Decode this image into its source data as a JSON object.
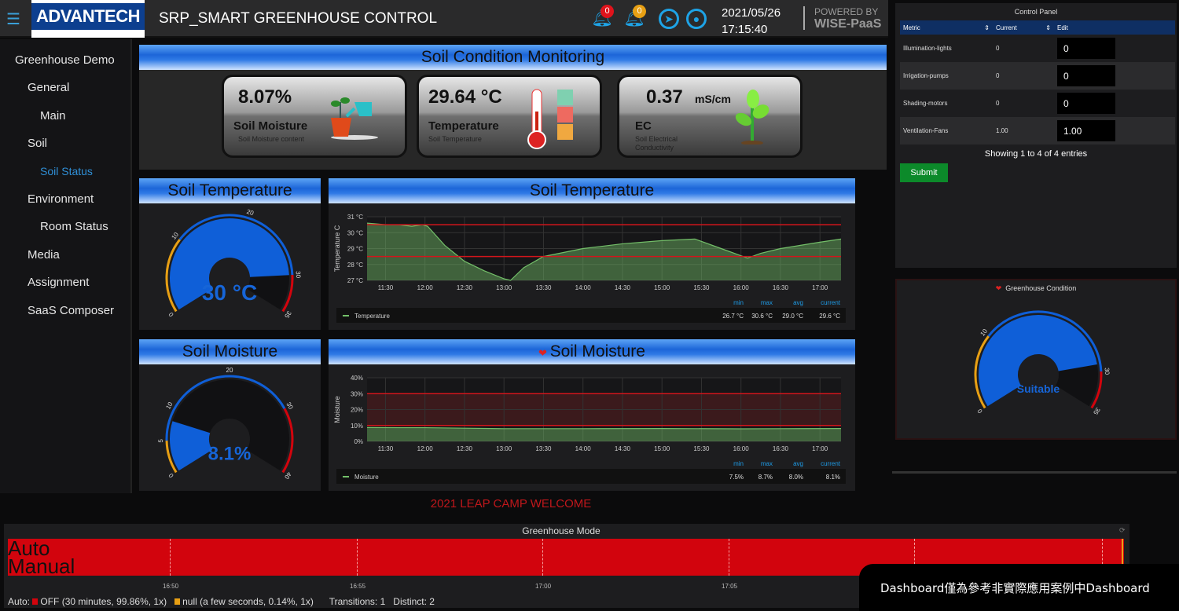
{
  "header": {
    "menu_icon": "hamburger-icon",
    "logo": "ADVANTECH",
    "title": "SRP_SMART GREENHOUSE CONTROL",
    "alerts": [
      {
        "icon": "bell-icon",
        "count": "0",
        "color": "#e0131b"
      },
      {
        "icon": "bell-icon",
        "count": "0",
        "color": "#e8a014"
      }
    ],
    "date": "2021/05/26",
    "time": "17:15:40",
    "powered_by": "POWERED BY",
    "platform": "WISE-PaaS"
  },
  "sidebar": {
    "items": [
      {
        "label": "Greenhouse Demo",
        "level": 0
      },
      {
        "label": "General",
        "level": 1
      },
      {
        "label": "Main",
        "level": 2
      },
      {
        "label": "Soil",
        "level": 1
      },
      {
        "label": "Soil Status",
        "level": 2,
        "active": true
      },
      {
        "label": "Environment",
        "level": 1
      },
      {
        "label": "Room Status",
        "level": 2
      },
      {
        "label": "Media",
        "level": 1
      },
      {
        "label": "Assignment",
        "level": 1
      },
      {
        "label": "SaaS Composer",
        "level": 1
      }
    ]
  },
  "soil_monitor": {
    "title": "Soil Condition Monitoring",
    "cards": [
      {
        "value": "8.07%",
        "name": "Soil Moisture",
        "sub": "Soil Moisture  content",
        "icon": "watering-can-icon"
      },
      {
        "value": "29.64 °C",
        "name": "Temperature",
        "sub": "Soil Temperature",
        "icon": "thermometer-icon"
      },
      {
        "value": "0.37",
        "unit": "mS/cm",
        "name": "EC",
        "sub": "Soil Electrical Conductivity",
        "icon": "sprout-icon"
      }
    ]
  },
  "gauges": {
    "temperature": {
      "title": "Soil Temperature",
      "display": "30 °C",
      "value": 30,
      "min": 0,
      "max": 35,
      "thresholds": [
        10,
        30
      ],
      "ticks": [
        0,
        10,
        20,
        30,
        35
      ]
    },
    "moisture": {
      "title": "Soil Moisture",
      "display": "8.1%",
      "value": 8.1,
      "min": 0,
      "max": 40,
      "thresholds": [
        5,
        30
      ],
      "ticks": [
        0,
        5,
        10,
        20,
        30,
        40
      ]
    },
    "condition": {
      "title": "Greenhouse Condition",
      "display": "Suitable",
      "value": 29,
      "min": 0,
      "max": 35,
      "thresholds": [
        10,
        30
      ],
      "ticks": [
        0,
        10,
        30,
        35
      ]
    }
  },
  "chart_data": [
    {
      "type": "area",
      "title": "Soil Temperature",
      "ylabel": "Temperature C",
      "ylim": [
        27,
        31
      ],
      "yunit": " °C",
      "yticks": [
        27,
        28,
        29,
        30,
        31
      ],
      "xticks": [
        "11:30",
        "12:00",
        "12:30",
        "13:00",
        "13:30",
        "14:00",
        "14:30",
        "15:00",
        "15:30",
        "16:00",
        "16:30",
        "17:00"
      ],
      "xlim": [
        "11:16",
        "17:16"
      ],
      "thresholds": [
        28.5,
        30.5
      ],
      "grid": true,
      "series": [
        {
          "name": "Temperature",
          "x": [
            "11:16",
            "11:30",
            "11:40",
            "11:50",
            "11:58",
            "12:02",
            "12:15",
            "12:30",
            "12:45",
            "13:00",
            "13:05",
            "13:15",
            "13:30",
            "14:00",
            "14:30",
            "15:00",
            "15:25",
            "15:45",
            "16:05",
            "16:15",
            "16:30",
            "17:00",
            "17:16"
          ],
          "y": [
            30.6,
            30.5,
            30.5,
            30.4,
            30.5,
            30.4,
            29.2,
            28.2,
            27.6,
            27.1,
            27.0,
            27.8,
            28.5,
            29.0,
            29.3,
            29.5,
            29.6,
            29.0,
            28.4,
            28.7,
            29.0,
            29.4,
            29.6
          ],
          "color": "#73bf69"
        }
      ],
      "legend": {
        "headers": [
          "min",
          "max",
          "avg",
          "current"
        ],
        "values": [
          "26.7 °C",
          "30.6 °C",
          "29.0 °C",
          "29.6 °C"
        ]
      }
    },
    {
      "type": "area",
      "title": "Soil Moisture",
      "ylabel": "Moisture",
      "ylim": [
        0,
        40
      ],
      "yunit": "%",
      "yticks": [
        0,
        10,
        20,
        30,
        40
      ],
      "xticks": [
        "11:30",
        "12:00",
        "12:30",
        "13:00",
        "13:30",
        "14:00",
        "14:30",
        "15:00",
        "15:30",
        "16:00",
        "16:30",
        "17:00"
      ],
      "xlim": [
        "11:16",
        "17:16"
      ],
      "thresholds": [
        10,
        30
      ],
      "grid": true,
      "series": [
        {
          "name": "Moisture",
          "x": [
            "11:16",
            "11:40",
            "12:00",
            "12:30",
            "13:00",
            "14:00",
            "15:00",
            "16:00",
            "16:30",
            "17:16"
          ],
          "y": [
            8.7,
            8.6,
            8.6,
            8.3,
            8.0,
            8.0,
            8.1,
            7.9,
            8.0,
            8.1
          ],
          "color": "#73bf69"
        }
      ],
      "legend": {
        "headers": [
          "min",
          "max",
          "avg",
          "current"
        ],
        "values": [
          "7.5%",
          "8.7%",
          "8.0%",
          "8.1%"
        ]
      }
    }
  ],
  "welcome": "2021 LEAP CAMP WELCOME",
  "control_panel": {
    "title": "Control Panel",
    "columns": [
      "Metric",
      "Current",
      "Edit"
    ],
    "rows": [
      {
        "metric": "Illumination-lights",
        "current": "0",
        "edit": "0"
      },
      {
        "metric": "Irrigation-pumps",
        "current": "0",
        "edit": "0"
      },
      {
        "metric": "Shading-motors",
        "current": "0",
        "edit": "0"
      },
      {
        "metric": "Ventilation-Fans",
        "current": "1.00",
        "edit": "1.00"
      }
    ],
    "showing": "Showing 1 to 4 of 4 entries",
    "submit": "Submit"
  },
  "greenhouse_mode": {
    "title": "Greenhouse Mode",
    "labels": [
      "Auto",
      "Manual"
    ],
    "ticks": [
      "16:50",
      "16:55",
      "17:00",
      "17:05"
    ],
    "legend": {
      "prefix": "Auto:",
      "off": "OFF (30 minutes, 99.86%, 1x)",
      "null": "null (a few seconds, 0.14%, 1x)",
      "transitions": "Transitions: 1",
      "distinct": "Distinct: 2"
    },
    "colors": {
      "off": "#d2040d",
      "null": "#e8a014"
    }
  },
  "notice": "Dashboard僅為參考非實際應用案例中Dashboard"
}
